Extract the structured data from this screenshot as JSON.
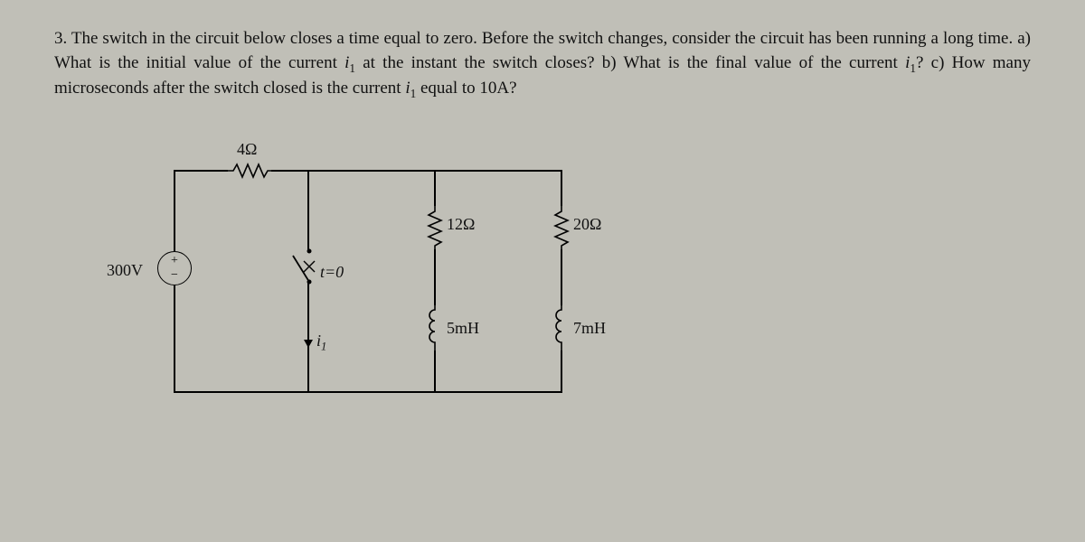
{
  "problem": {
    "number": "3.",
    "text_part1": "The switch in the circuit below closes a time equal to zero. Before the switch changes, consider the circuit has been running a long time. a) What is the initial value of the current ",
    "i1_a": "i",
    "sub1_a": "1",
    "text_part2": " at the instant the switch closes? b) What is the final value of the current ",
    "i1_b": "i",
    "sub1_b": "1",
    "text_part3": "? c) How many microseconds after the switch closed is the current ",
    "i1_c": "i",
    "sub1_c": "1",
    "text_part4": " equal to 10A?"
  },
  "circuit": {
    "source_label": "300V",
    "r_top": "4Ω",
    "r_mid_left": "12Ω",
    "r_mid_right": "20Ω",
    "l_left": "5mH",
    "l_right": "7mH",
    "switch_label": "t=0",
    "current_label": "i",
    "current_sub": "1"
  }
}
